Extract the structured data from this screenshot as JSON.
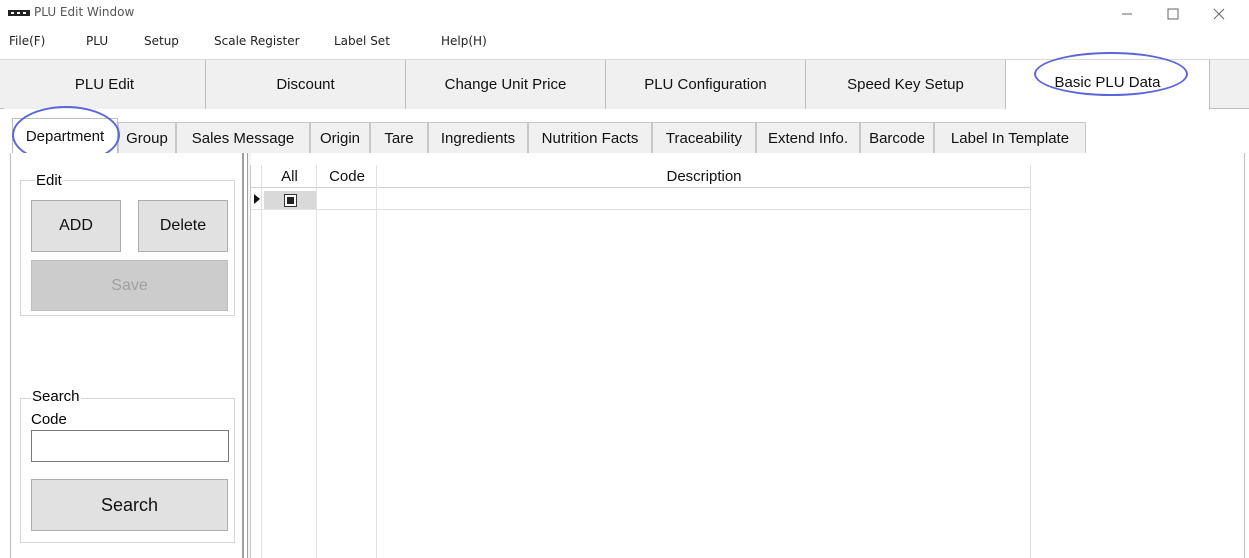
{
  "window": {
    "title": "PLU Edit Window"
  },
  "menu": [
    "File(F)",
    "PLU",
    "Setup",
    "Scale Register",
    "Label Set",
    "Help(H)"
  ],
  "top_tabs": [
    "PLU Edit",
    "Discount",
    "Change Unit Price",
    "PLU Configuration",
    "Speed Key Setup",
    "Basic PLU Data"
  ],
  "top_tabs_active": "Basic PLU Data",
  "sub_tabs": [
    "Department",
    "Group",
    "Sales Message",
    "Origin",
    "Tare",
    "Ingredients",
    "Nutrition Facts",
    "Traceability",
    "Extend Info.",
    "Barcode",
    "Label In Template"
  ],
  "sub_tabs_active": "Department",
  "edit_group": {
    "label": "Edit",
    "add_label": "ADD",
    "delete_label": "Delete",
    "save_label": "Save"
  },
  "search_group": {
    "label": "Search",
    "code_label": "Code",
    "code_value": "",
    "search_label": "Search"
  },
  "grid": {
    "columns": [
      "All",
      "Code",
      "Description"
    ],
    "rows": [
      {
        "all_checked": true,
        "code": "",
        "description": ""
      }
    ]
  },
  "colors": {
    "highlight_ring": "#5b67d8",
    "tab_bg": "#f0f0f0",
    "button_bg": "#e1e1e1",
    "disabled_button_bg": "#cccccc"
  }
}
